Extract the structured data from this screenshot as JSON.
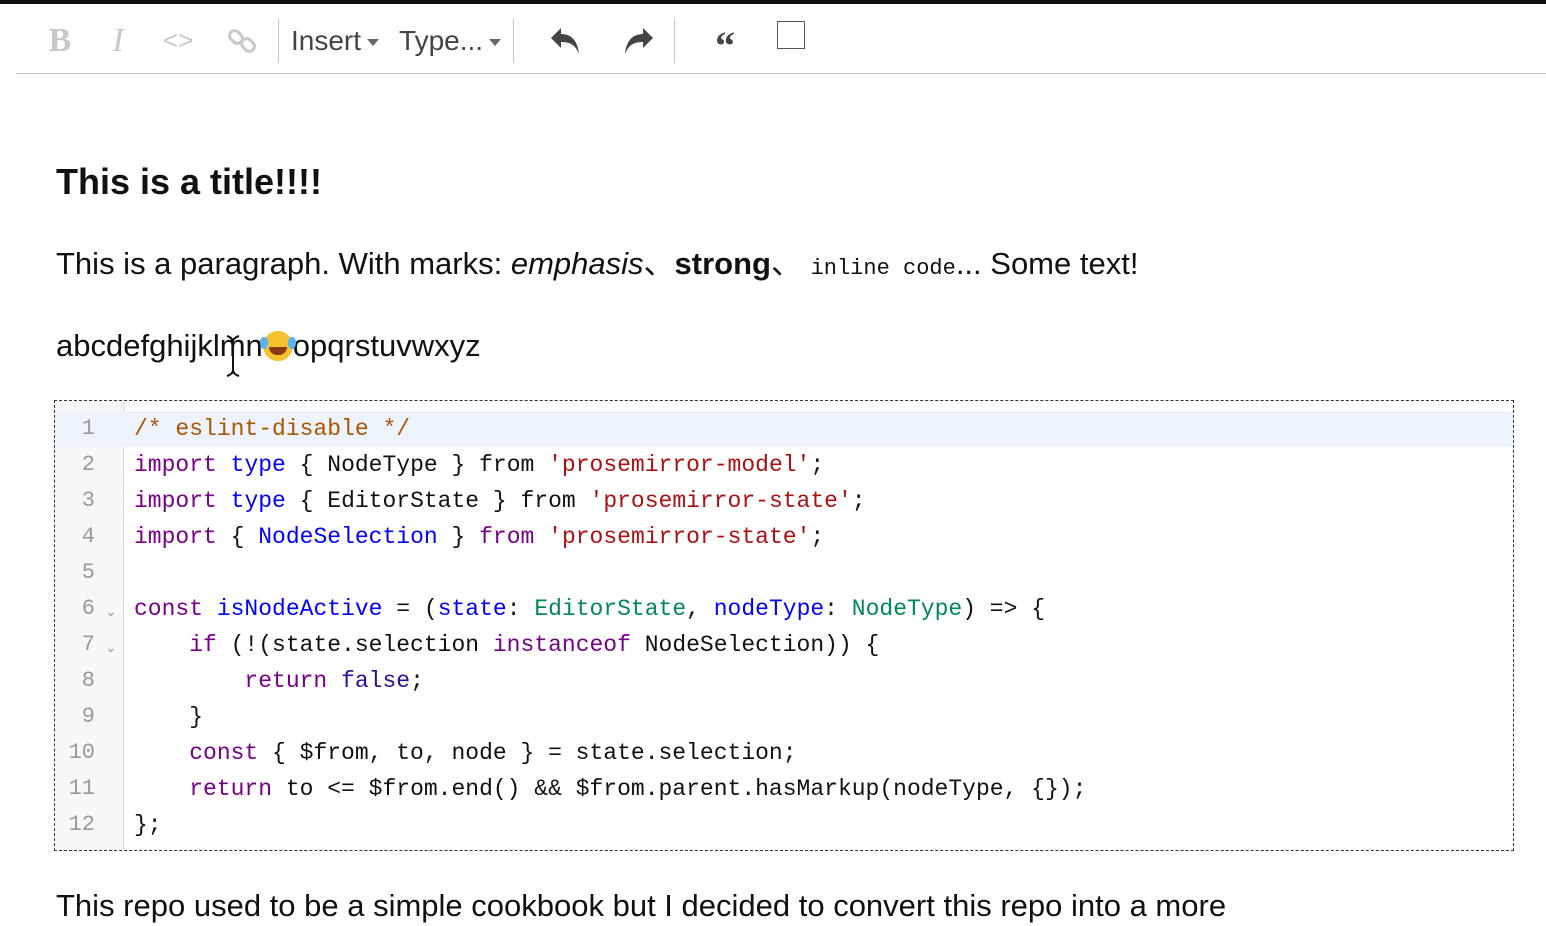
{
  "toolbar": {
    "bold_label": "B",
    "italic_label": "I",
    "code_label": "<>",
    "link_icon": "link-icon",
    "insert_label": "Insert",
    "type_label": "Type...",
    "undo_icon": "undo-icon",
    "redo_icon": "redo-icon",
    "quote_label": "“",
    "select_block_icon": "select-block-icon"
  },
  "document": {
    "title": "This is a title!!!!",
    "paragraph1": {
      "prefix": "This is a paragraph. With marks: ",
      "emphasis": "emphasis",
      "sep1": "、",
      "strong": "strong",
      "sep2": "、 ",
      "code": "inline code",
      "suffix": "... Some text!"
    },
    "paragraph2": {
      "before": "abcdefghijklmn",
      "emoji": "face-with-tears-of-joy",
      "after": "opqrstuvwxyz"
    },
    "code_lines": [
      {
        "n": "1",
        "fold": ""
      },
      {
        "n": "2",
        "fold": ""
      },
      {
        "n": "3",
        "fold": ""
      },
      {
        "n": "4",
        "fold": ""
      },
      {
        "n": "5",
        "fold": ""
      },
      {
        "n": "6",
        "fold": "⌄"
      },
      {
        "n": "7",
        "fold": "⌄"
      },
      {
        "n": "8",
        "fold": ""
      },
      {
        "n": "9",
        "fold": ""
      },
      {
        "n": "10",
        "fold": ""
      },
      {
        "n": "11",
        "fold": ""
      },
      {
        "n": "12",
        "fold": ""
      }
    ],
    "code": {
      "l1": "/* eslint-disable */",
      "l2_kw1": "import",
      "l2_kw2": "type",
      "l2_a": " { NodeType } from ",
      "l2_str": "'prosemirror-model'",
      "l2_end": ";",
      "l3_kw1": "import",
      "l3_kw2": "type",
      "l3_a": " { EditorState } from ",
      "l3_str": "'prosemirror-state'",
      "l3_end": ";",
      "l4_kw1": "import",
      "l4_a": " { ",
      "l4_def": "NodeSelection",
      "l4_b": " } ",
      "l4_kw2": "from",
      "l4_str": "'prosemirror-state'",
      "l4_end": ";",
      "l6_kw": "const",
      "l6_def": "isNodeActive",
      "l6_a": " = (",
      "l6_v1": "state",
      "l6_b": ": ",
      "l6_t1": "EditorState",
      "l6_c": ", ",
      "l6_v2": "nodeType",
      "l6_d": ": ",
      "l6_t2": "NodeType",
      "l6_e": ") => {",
      "l7_kw": "if",
      "l7_a": " (!(state.selection ",
      "l7_kw2": "instanceof",
      "l7_b": " NodeSelection)) {",
      "l8_kw": "return",
      "l8_atom": "false",
      "l8_end": ";",
      "l9": "}",
      "l10_kw": "const",
      "l10_a": " { $from, to, node } = state.selection;",
      "l11_kw": "return",
      "l11_a": " to <= $from.end() && $from.parent.hasMarkup(nodeType, {});",
      "l12": "};"
    },
    "paragraph3": "This repo used to be a simple cookbook but I decided to convert this repo into a more"
  }
}
